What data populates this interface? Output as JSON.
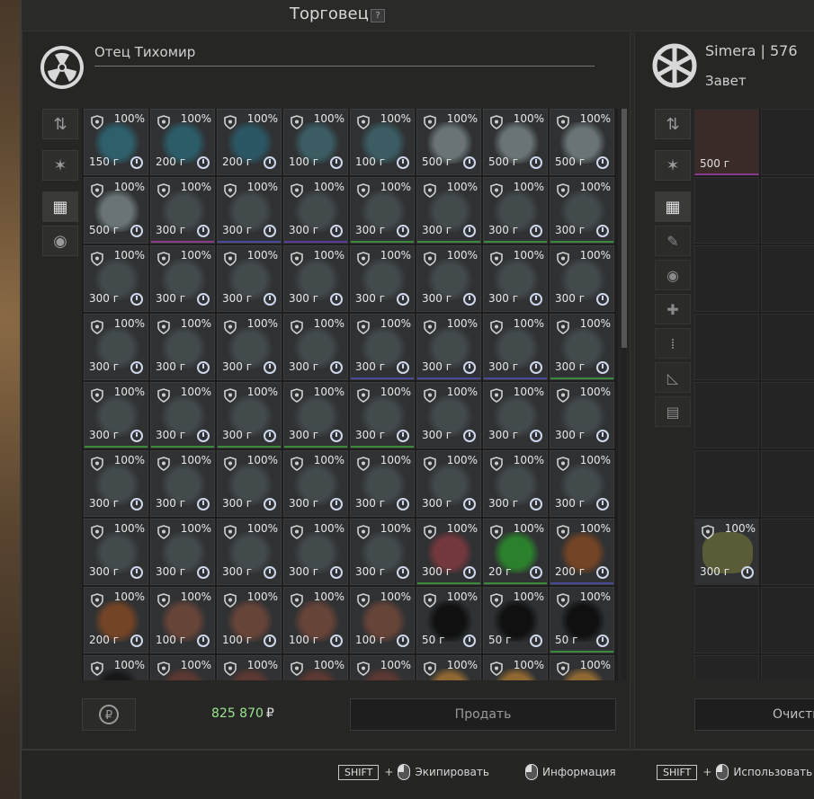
{
  "title": "Торговец",
  "help_label": "?",
  "trader": {
    "name": "Отец Тихомир"
  },
  "player": {
    "name": "Simera | 576",
    "faction": "Завет"
  },
  "money": {
    "value": "825 870",
    "currency": "₽"
  },
  "buttons": {
    "sell": "Продать",
    "clear": "Очисти"
  },
  "footer": {
    "hint1": {
      "key": "SHIFT",
      "plus": "+",
      "label": "Экипировать"
    },
    "hint2": {
      "label": "Информация"
    },
    "hint3": {
      "key": "SHIFT",
      "plus": "+",
      "label": "Использовать"
    }
  },
  "inventory": {
    "items": [
      {
        "pct": "100%",
        "weight": "150 г",
        "color": "#2e6e7e",
        "line": ""
      },
      {
        "pct": "100%",
        "weight": "200 г",
        "color": "#2b6a7a",
        "line": ""
      },
      {
        "pct": "100%",
        "weight": "200 г",
        "color": "#2a6273",
        "line": ""
      },
      {
        "pct": "100%",
        "weight": "100 г",
        "color": "#3e6a72",
        "line": ""
      },
      {
        "pct": "100%",
        "weight": "100 г",
        "color": "#3e6a72",
        "line": ""
      },
      {
        "pct": "100%",
        "weight": "500 г",
        "color": "#7d8a8c",
        "line": ""
      },
      {
        "pct": "100%",
        "weight": "500 г",
        "color": "#7d8a8c",
        "line": ""
      },
      {
        "pct": "100%",
        "weight": "500 г",
        "color": "#7d8a8c",
        "line": ""
      },
      {
        "pct": "100%",
        "weight": "500 г",
        "color": "#7d8a8c",
        "line": ""
      },
      {
        "pct": "100%",
        "weight": "300 г",
        "color": "#4a5255",
        "line": "#8a3a8a"
      },
      {
        "pct": "100%",
        "weight": "300 г",
        "color": "#4a5255",
        "line": "#4a4a9a"
      },
      {
        "pct": "100%",
        "weight": "300 г",
        "color": "#4a5255",
        "line": "#5a3a9a"
      },
      {
        "pct": "100%",
        "weight": "300 г",
        "color": "#4a5255",
        "line": "#3a8a3a"
      },
      {
        "pct": "100%",
        "weight": "300 г",
        "color": "#4a5255",
        "line": "#3a8a3a"
      },
      {
        "pct": "100%",
        "weight": "300 г",
        "color": "#4a5255",
        "line": "#3a8a3a"
      },
      {
        "pct": "100%",
        "weight": "300 г",
        "color": "#4a5255",
        "line": "#3a8a3a"
      },
      {
        "pct": "100%",
        "weight": "300 г",
        "color": "#4a5255",
        "line": ""
      },
      {
        "pct": "100%",
        "weight": "300 г",
        "color": "#4a5255",
        "line": ""
      },
      {
        "pct": "100%",
        "weight": "300 г",
        "color": "#4a5255",
        "line": ""
      },
      {
        "pct": "100%",
        "weight": "300 г",
        "color": "#4a5255",
        "line": ""
      },
      {
        "pct": "100%",
        "weight": "300 г",
        "color": "#4a5255",
        "line": ""
      },
      {
        "pct": "100%",
        "weight": "300 г",
        "color": "#4a5255",
        "line": ""
      },
      {
        "pct": "100%",
        "weight": "300 г",
        "color": "#4a5255",
        "line": ""
      },
      {
        "pct": "100%",
        "weight": "300 г",
        "color": "#4a5255",
        "line": ""
      },
      {
        "pct": "100%",
        "weight": "300 г",
        "color": "#4a5255",
        "line": ""
      },
      {
        "pct": "100%",
        "weight": "300 г",
        "color": "#4a5255",
        "line": ""
      },
      {
        "pct": "100%",
        "weight": "300 г",
        "color": "#4a5255",
        "line": ""
      },
      {
        "pct": "100%",
        "weight": "300 г",
        "color": "#4a5255",
        "line": ""
      },
      {
        "pct": "100%",
        "weight": "300 г",
        "color": "#4a5255",
        "line": "#4a4a9a"
      },
      {
        "pct": "100%",
        "weight": "300 г",
        "color": "#4a5255",
        "line": "#4a4a9a"
      },
      {
        "pct": "100%",
        "weight": "300 г",
        "color": "#4a5255",
        "line": "#4a4a9a"
      },
      {
        "pct": "100%",
        "weight": "300 г",
        "color": "#4a5255",
        "line": "#3a8a3a"
      },
      {
        "pct": "100%",
        "weight": "300 г",
        "color": "#4a5255",
        "line": "#3a8a3a"
      },
      {
        "pct": "100%",
        "weight": "300 г",
        "color": "#4a5255",
        "line": "#3a8a3a"
      },
      {
        "pct": "100%",
        "weight": "300 г",
        "color": "#4a5255",
        "line": "#3a8a3a"
      },
      {
        "pct": "100%",
        "weight": "300 г",
        "color": "#4a5255",
        "line": "#3a8a3a"
      },
      {
        "pct": "100%",
        "weight": "300 г",
        "color": "#4a5255",
        "line": "#3a8a3a"
      },
      {
        "pct": "100%",
        "weight": "300 г",
        "color": "#4a5255",
        "line": ""
      },
      {
        "pct": "100%",
        "weight": "300 г",
        "color": "#4a5255",
        "line": ""
      },
      {
        "pct": "100%",
        "weight": "300 г",
        "color": "#4a5255",
        "line": ""
      },
      {
        "pct": "100%",
        "weight": "300 г",
        "color": "#4a5255",
        "line": ""
      },
      {
        "pct": "100%",
        "weight": "300 г",
        "color": "#4a5255",
        "line": ""
      },
      {
        "pct": "100%",
        "weight": "300 г",
        "color": "#4a5255",
        "line": ""
      },
      {
        "pct": "100%",
        "weight": "300 г",
        "color": "#4a5255",
        "line": ""
      },
      {
        "pct": "100%",
        "weight": "300 г",
        "color": "#4a5255",
        "line": ""
      },
      {
        "pct": "100%",
        "weight": "300 г",
        "color": "#4a5255",
        "line": ""
      },
      {
        "pct": "100%",
        "weight": "300 г",
        "color": "#4a5255",
        "line": ""
      },
      {
        "pct": "100%",
        "weight": "300 г",
        "color": "#4a5255",
        "line": ""
      },
      {
        "pct": "100%",
        "weight": "300 г",
        "color": "#4a5255",
        "line": ""
      },
      {
        "pct": "100%",
        "weight": "300 г",
        "color": "#4a5255",
        "line": ""
      },
      {
        "pct": "100%",
        "weight": "300 г",
        "color": "#4a5255",
        "line": ""
      },
      {
        "pct": "100%",
        "weight": "300 г",
        "color": "#4a5255",
        "line": ""
      },
      {
        "pct": "100%",
        "weight": "300 г",
        "color": "#4a5255",
        "line": ""
      },
      {
        "pct": "100%",
        "weight": "300 г",
        "color": "#8a3a40",
        "line": "#3a8a3a"
      },
      {
        "pct": "100%",
        "weight": "20 г",
        "color": "#2a9a2a",
        "line": "#3a8a3a"
      },
      {
        "pct": "100%",
        "weight": "200 г",
        "color": "#8a4a20",
        "line": "#4a4a9a"
      },
      {
        "pct": "100%",
        "weight": "200 г",
        "color": "#8a4a20",
        "line": ""
      },
      {
        "pct": "100%",
        "weight": "100 г",
        "color": "#7a4a3a",
        "line": ""
      },
      {
        "pct": "100%",
        "weight": "100 г",
        "color": "#7a4a3a",
        "line": ""
      },
      {
        "pct": "100%",
        "weight": "100 г",
        "color": "#7a4a3a",
        "line": ""
      },
      {
        "pct": "100%",
        "weight": "100 г",
        "color": "#7a4a3a",
        "line": ""
      },
      {
        "pct": "100%",
        "weight": "50 г",
        "color": "#050505",
        "line": ""
      },
      {
        "pct": "100%",
        "weight": "50 г",
        "color": "#050505",
        "line": ""
      },
      {
        "pct": "100%",
        "weight": "50 г",
        "color": "#050505",
        "line": "#3a8a3a"
      },
      {
        "pct": "100%",
        "weight": "",
        "color": "#101010",
        "line": ""
      },
      {
        "pct": "100%",
        "weight": "",
        "color": "#6a3a30",
        "line": ""
      },
      {
        "pct": "100%",
        "weight": "",
        "color": "#6a3a30",
        "line": ""
      },
      {
        "pct": "100%",
        "weight": "",
        "color": "#6a3a30",
        "line": ""
      },
      {
        "pct": "100%",
        "weight": "",
        "color": "#6a3a30",
        "line": ""
      },
      {
        "pct": "100%",
        "weight": "",
        "color": "#b07a30",
        "line": ""
      },
      {
        "pct": "100%",
        "weight": "",
        "color": "#b07a30",
        "line": ""
      },
      {
        "pct": "100%",
        "weight": "",
        "color": "#b07a30",
        "line": ""
      }
    ]
  },
  "player_inventory": {
    "items": [
      {
        "weight": "500 г"
      },
      {
        "pct": "100%",
        "weight": "300 г"
      }
    ]
  }
}
